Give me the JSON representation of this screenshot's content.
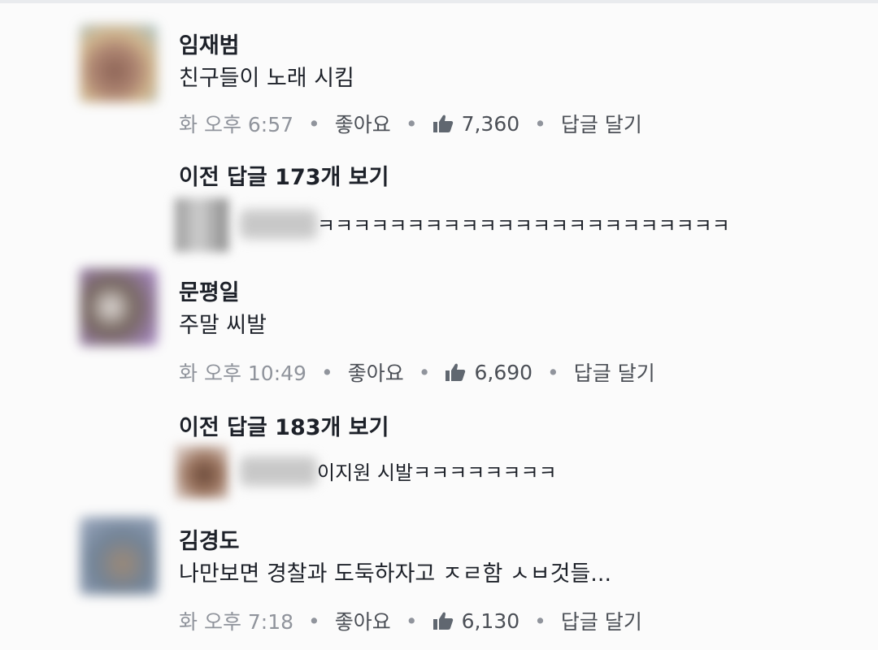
{
  "comments": [
    {
      "author": "임재범",
      "text": "친구들이 노래 시킴",
      "time": "화 오후 6:57",
      "like_label": "좋아요",
      "like_count": "7,360",
      "reply_label": "답글 달기",
      "view_more": "이전 답글 173개 보기",
      "reply_text": "ㅋㅋㅋㅋㅋㅋㅋㅋㅋㅋㅋㅋㅋㅋㅋㅋㅋㅋㅋㅋㅋㅋㅋ"
    },
    {
      "author": "문평일",
      "text": "주말 씨발",
      "time": "화 오후 10:49",
      "like_label": "좋아요",
      "like_count": "6,690",
      "reply_label": "답글 달기",
      "view_more": "이전 답글 183개 보기",
      "reply_text": "이지원 시발ㅋㅋㅋㅋㅋㅋㅋㅋ"
    },
    {
      "author": "김경도",
      "text": "나만보면 경찰과 도둑하자고 ㅈㄹ함 ㅅㅂ것들...",
      "time": "화 오후 7:18",
      "like_label": "좋아요",
      "like_count": "6,130",
      "reply_label": "답글 달기"
    }
  ],
  "colors": {
    "text": "#1d2129",
    "meta": "#90949c",
    "action": "#4b4f56"
  },
  "icons": {
    "like": "thumbs-up-icon",
    "dot": "middle-dot"
  }
}
